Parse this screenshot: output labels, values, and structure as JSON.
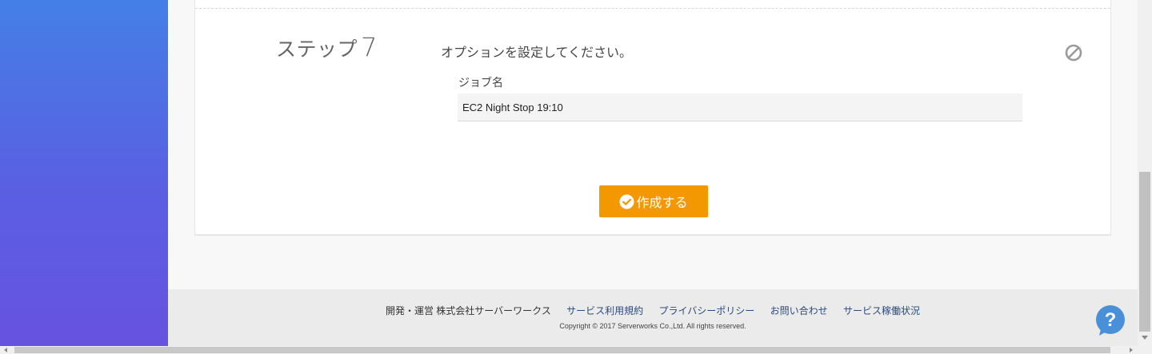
{
  "step": {
    "label": "ステップ",
    "number": "7",
    "instruction": "オプションを設定してください。"
  },
  "form": {
    "job_name_label": "ジョブ名",
    "job_name_value": "EC2 Night Stop 19:10"
  },
  "actions": {
    "create_label": "作成する",
    "disable_icon": "block-icon"
  },
  "footer": {
    "company": "開発・運営 株式会社サーバーワークス",
    "links": [
      "サービス利用規約",
      "プライバシーポリシー",
      "お問い合わせ",
      "サービス稼働状況"
    ],
    "copyright": "Copyright © 2017 Serverworks Co.,Ltd. All rights reserved."
  },
  "help": {
    "icon": "help-icon",
    "glyph": "?"
  },
  "colors": {
    "accent": "#f39800",
    "sidebar_top": "#447fe6",
    "sidebar_bottom": "#6752e0",
    "help_blue": "#4a90d9"
  }
}
